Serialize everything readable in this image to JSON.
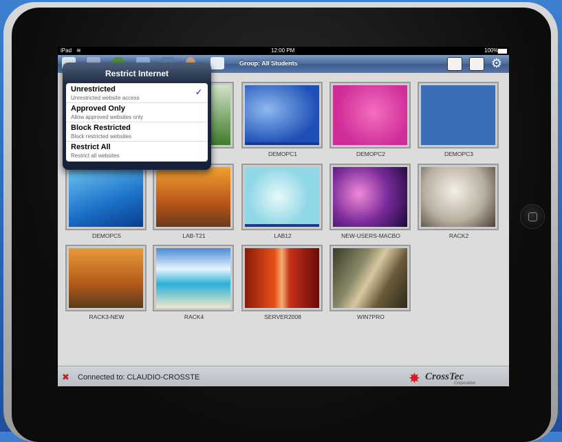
{
  "statusbar": {
    "device": "iPad",
    "time": "12:00 PM",
    "battery": "100%"
  },
  "toolbar": {
    "group_title": "Group: All Students",
    "icons": [
      "home-icon",
      "grid-icon",
      "globe-icon",
      "monitor-icon",
      "screen-icon",
      "user-icon",
      "printer-icon"
    ],
    "right_icons": [
      "thumbnail-view-icon",
      "list-view-icon",
      "settings-icon"
    ]
  },
  "popover": {
    "title": "Restrict Internet",
    "options": [
      {
        "title": "Unrestricted",
        "subtitle": "Unrestricted website access",
        "selected": true
      },
      {
        "title": "Approved Only",
        "subtitle": "Allow approved websites only",
        "selected": false
      },
      {
        "title": "Block Restricted",
        "subtitle": "Block restricted websites",
        "selected": false
      },
      {
        "title": "Restrict All",
        "subtitle": "Restrict all websites",
        "selected": false
      }
    ],
    "checkmark": "✓"
  },
  "computers": [
    {
      "name": "",
      "theme": "green"
    },
    {
      "name": "DEMOPC1",
      "theme": "xp"
    },
    {
      "name": "DEMOPC2",
      "theme": "pink"
    },
    {
      "name": "DEMOPC3",
      "theme": "blue"
    },
    {
      "name": "DEMOPC5",
      "theme": "wave"
    },
    {
      "name": "LAB-T21",
      "theme": "autumn"
    },
    {
      "name": "LAB12",
      "theme": "cyan"
    },
    {
      "name": "NEW-USERS-MACBO",
      "theme": "mac"
    },
    {
      "name": "RACK2",
      "theme": "dog"
    },
    {
      "name": "RACK3-NEW",
      "theme": "autumn"
    },
    {
      "name": "RACK4",
      "theme": "beach"
    },
    {
      "name": "SERVER2008",
      "theme": "canyon"
    },
    {
      "name": "WIN7PRO",
      "theme": "abstract"
    }
  ],
  "footer": {
    "connection": "Connected to: CLAUDIO-CROSSTE",
    "logo_name": "CrossTec",
    "logo_sub": "Corporation"
  },
  "colors": {
    "toolbar": "#4a6a9a",
    "accent": "#3a5fa8",
    "logo_red": "#d61c1c"
  }
}
